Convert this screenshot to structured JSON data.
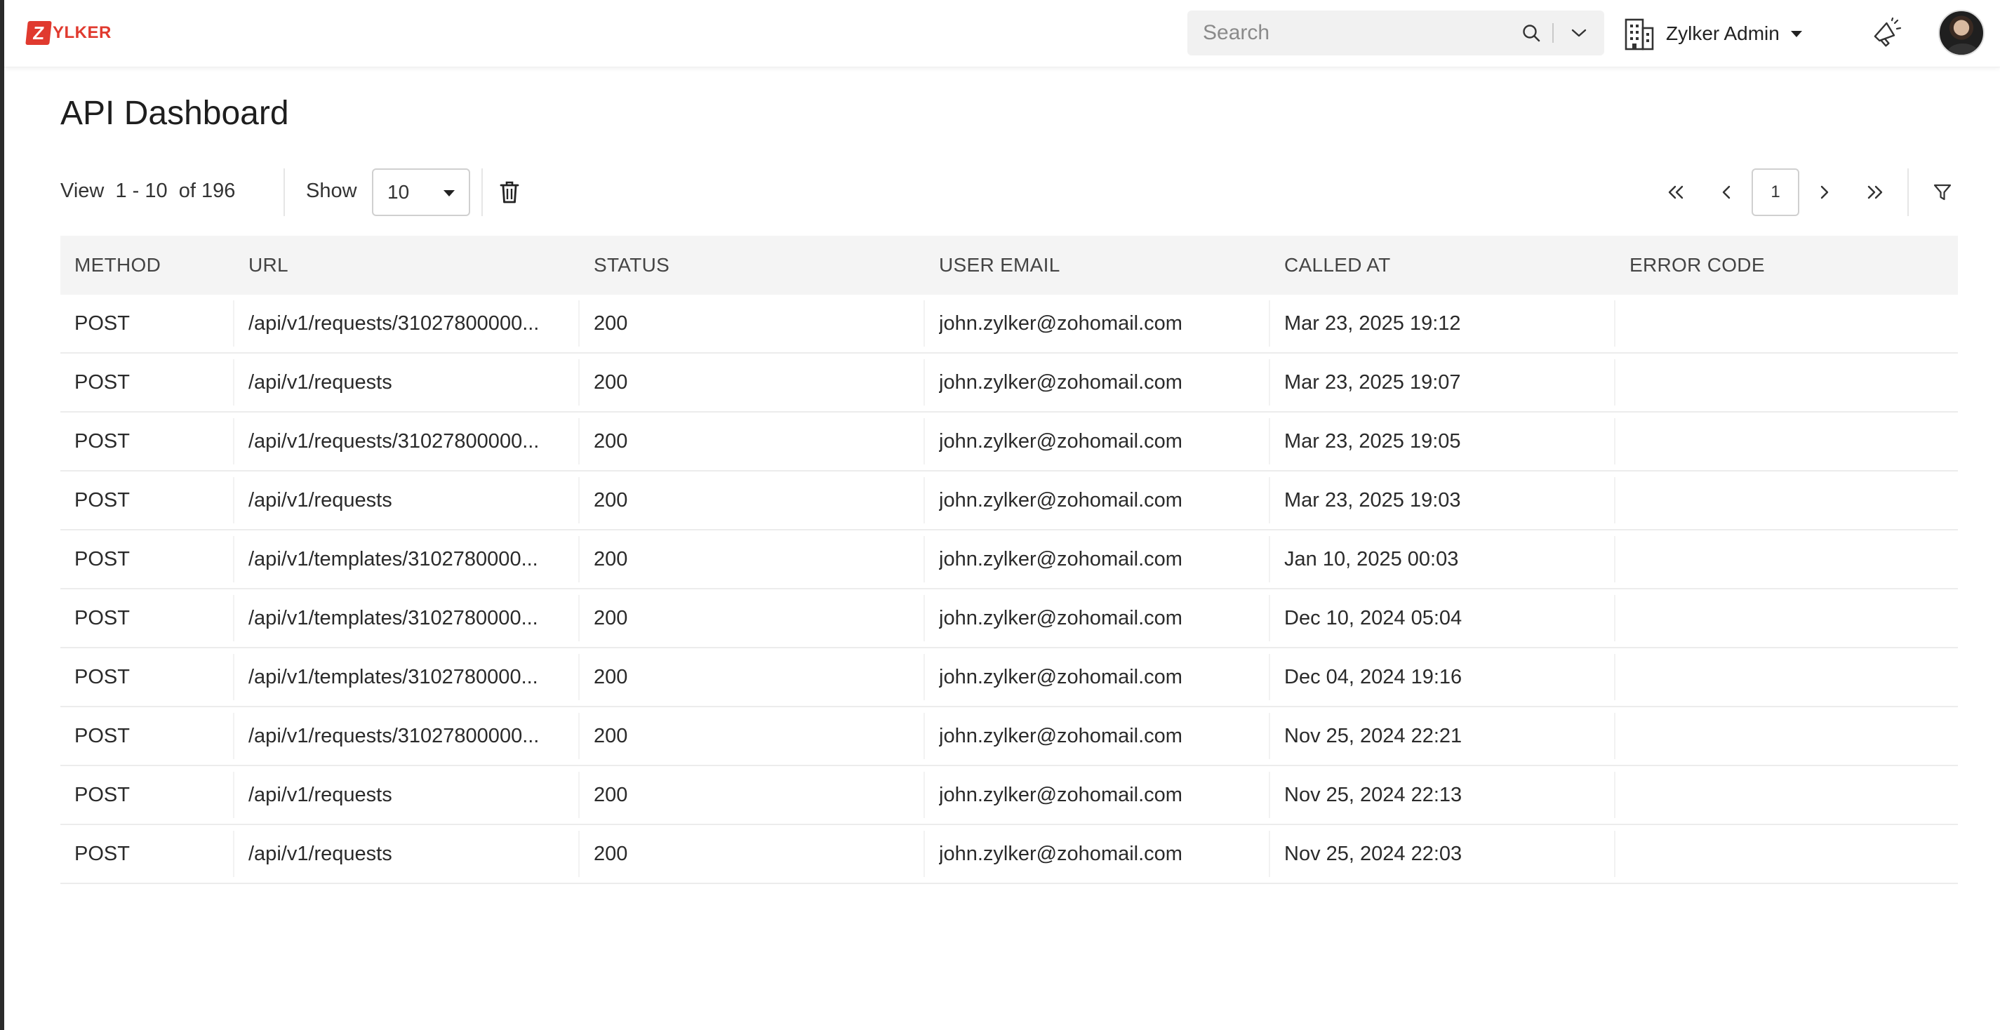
{
  "header": {
    "logo_letter": "Z",
    "logo_text": "YLKER",
    "search_placeholder": "Search",
    "org_name": "Zylker Admin"
  },
  "page": {
    "title": "API Dashboard"
  },
  "toolbar": {
    "view_label": "View",
    "range_start": "1",
    "range_end": "- 10",
    "of_label": "of",
    "total": "196",
    "show_label": "Show",
    "page_size": "10",
    "current_page": "1"
  },
  "table": {
    "columns": [
      "METHOD",
      "URL",
      "STATUS",
      "USER EMAIL",
      "CALLED AT",
      "ERROR CODE"
    ],
    "rows": [
      {
        "method": "POST",
        "url": "/api/v1/requests/31027800000...",
        "status": "200",
        "email": "john.zylker@zohomail.com",
        "called_at": "Mar 23, 2025 19:12",
        "error_code": ""
      },
      {
        "method": "POST",
        "url": "/api/v1/requests",
        "status": "200",
        "email": "john.zylker@zohomail.com",
        "called_at": "Mar 23, 2025 19:07",
        "error_code": ""
      },
      {
        "method": "POST",
        "url": "/api/v1/requests/31027800000...",
        "status": "200",
        "email": "john.zylker@zohomail.com",
        "called_at": "Mar 23, 2025 19:05",
        "error_code": ""
      },
      {
        "method": "POST",
        "url": "/api/v1/requests",
        "status": "200",
        "email": "john.zylker@zohomail.com",
        "called_at": "Mar 23, 2025 19:03",
        "error_code": ""
      },
      {
        "method": "POST",
        "url": "/api/v1/templates/3102780000...",
        "status": "200",
        "email": "john.zylker@zohomail.com",
        "called_at": "Jan 10, 2025 00:03",
        "error_code": ""
      },
      {
        "method": "POST",
        "url": "/api/v1/templates/3102780000...",
        "status": "200",
        "email": "john.zylker@zohomail.com",
        "called_at": "Dec 10, 2024 05:04",
        "error_code": ""
      },
      {
        "method": "POST",
        "url": "/api/v1/templates/3102780000...",
        "status": "200",
        "email": "john.zylker@zohomail.com",
        "called_at": "Dec 04, 2024 19:16",
        "error_code": ""
      },
      {
        "method": "POST",
        "url": "/api/v1/requests/31027800000...",
        "status": "200",
        "email": "john.zylker@zohomail.com",
        "called_at": "Nov 25, 2024 22:21",
        "error_code": ""
      },
      {
        "method": "POST",
        "url": "/api/v1/requests",
        "status": "200",
        "email": "john.zylker@zohomail.com",
        "called_at": "Nov 25, 2024 22:13",
        "error_code": ""
      },
      {
        "method": "POST",
        "url": "/api/v1/requests",
        "status": "200",
        "email": "john.zylker@zohomail.com",
        "called_at": "Nov 25, 2024 22:03",
        "error_code": ""
      }
    ]
  },
  "icons": {
    "search": "search-icon",
    "chevron": "chevron-down-icon",
    "org": "building-icon",
    "announce": "megaphone-icon",
    "delete": "trash-icon",
    "first": "double-chevron-left-icon",
    "prev": "chevron-left-icon",
    "next": "chevron-right-icon",
    "last": "double-chevron-right-icon",
    "filter": "filter-icon"
  },
  "colors": {
    "brand": "#e03a2f",
    "header_bg": "#f4f4f4"
  }
}
